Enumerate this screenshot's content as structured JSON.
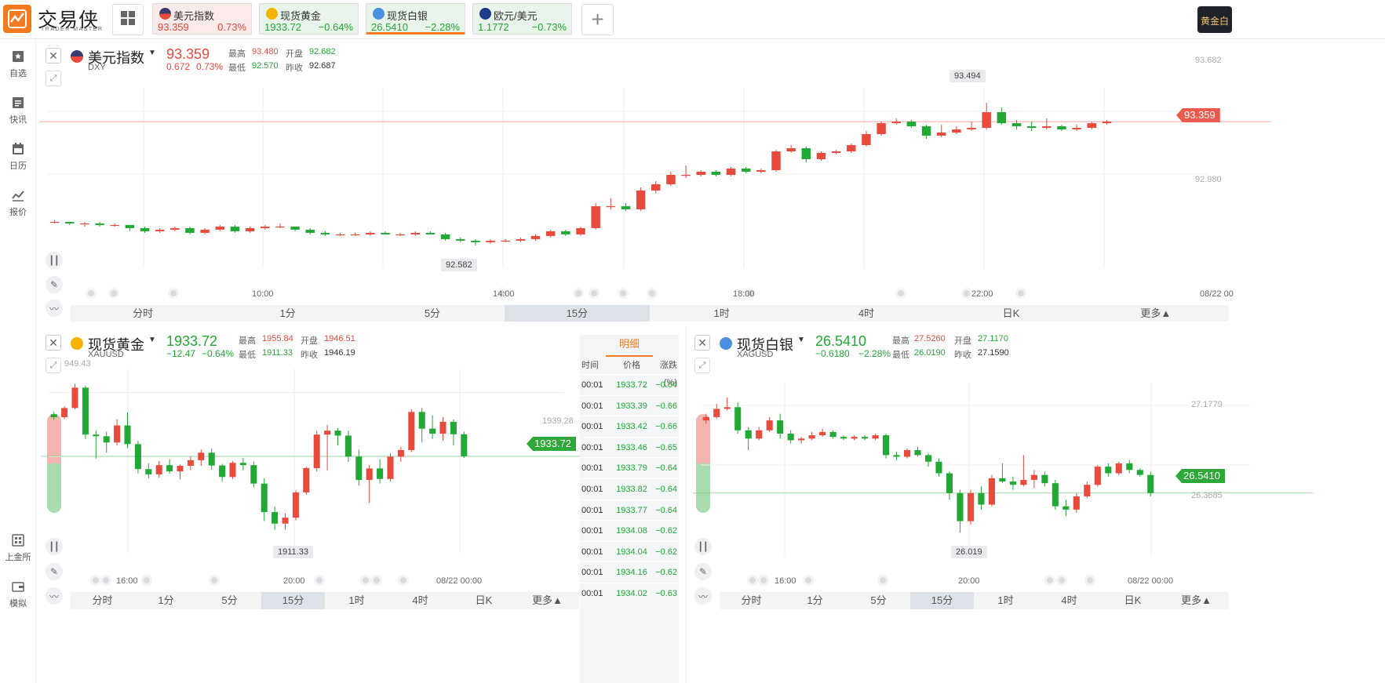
{
  "app": {
    "name": "交易侠",
    "sub": "TRADER MASTER",
    "right_badge": "黄金白"
  },
  "tickers": [
    {
      "name": "美元指数",
      "price": "93.359",
      "change": "0.73%",
      "dir": "up"
    },
    {
      "name": "现货黄金",
      "price": "1933.72",
      "change": "−0.64%",
      "dir": "down"
    },
    {
      "name": "现货白银",
      "price": "26.5410",
      "change": "−2.28%",
      "dir": "down"
    },
    {
      "name": "欧元/美元",
      "price": "1.1772",
      "change": "−0.73%",
      "dir": "down"
    }
  ],
  "sidebar": [
    {
      "label": "自选",
      "icon": "bookmark-icon"
    },
    {
      "label": "快讯",
      "icon": "news-icon"
    },
    {
      "label": "日历",
      "icon": "calendar-icon"
    },
    {
      "label": "报价",
      "icon": "chart-line-icon"
    },
    {
      "label": "上金所",
      "icon": "exchange-icon"
    },
    {
      "label": "模拟",
      "icon": "wallet-icon"
    }
  ],
  "timeframes": [
    "分时",
    "1分",
    "5分",
    "15分",
    "1时",
    "4时",
    "日K",
    "更多▲"
  ],
  "active_timeframe": "15分",
  "colors": {
    "up": "#e84a3c",
    "down": "#22a835",
    "accent": "#f47a1f"
  },
  "dxy": {
    "title": "美元指数",
    "code": "DXY",
    "price": "93.359",
    "chg": "0.672",
    "pct": "0.73%",
    "high_label": "最高",
    "high": "93.480",
    "open_label": "开盘",
    "open": "92.682",
    "low_label": "最低",
    "low": "92.570",
    "prev_label": "昨收",
    "prev": "92.687",
    "x_labels": [
      "10:00",
      "14:00",
      "18:00",
      "22:00",
      "08/22 00"
    ],
    "y_labels": [
      "93.682",
      "92.980"
    ],
    "hi_mark": "93.494",
    "lo_mark": "92.582",
    "last": "93.359"
  },
  "gold": {
    "title": "现货黄金",
    "code": "XAUUSD",
    "price": "1933.72",
    "chg": "−12.47",
    "pct": "−0.64%",
    "high_label": "最高",
    "high": "1955.84",
    "open_label": "开盘",
    "open": "1946.51",
    "low_label": "最低",
    "low": "1911.33",
    "prev_label": "昨收",
    "prev": "1946.19",
    "x_labels": [
      "16:00",
      "20:00",
      "08/22 00:00"
    ],
    "y_labels": [
      "1939.28"
    ],
    "top_partial": "949.43",
    "lo_mark": "1911.33",
    "last": "1933.72"
  },
  "silver": {
    "title": "现货白银",
    "code": "XAGUSD",
    "price": "26.5410",
    "chg": "−0.6180",
    "pct": "−2.28%",
    "high_label": "最高",
    "high": "27.5260",
    "open_label": "开盘",
    "open": "27.1170",
    "low_label": "最低",
    "low": "26.0190",
    "prev_label": "昨收",
    "prev": "27.1590",
    "x_labels": [
      "16:00",
      "20:00",
      "08/22 00:00"
    ],
    "y_labels": [
      "27.1779",
      "26.3685"
    ],
    "lo_mark": "26.019",
    "last": "26.5410"
  },
  "detail": {
    "tab": "明细",
    "headers": [
      "时间",
      "价格",
      "涨跌(%)"
    ],
    "rows": [
      [
        "00:01",
        "1933.72",
        "−0.64"
      ],
      [
        "00:01",
        "1933.39",
        "−0.66"
      ],
      [
        "00:01",
        "1933.42",
        "−0.66"
      ],
      [
        "00:01",
        "1933.46",
        "−0.65"
      ],
      [
        "00:01",
        "1933.79",
        "−0.64"
      ],
      [
        "00:01",
        "1933.82",
        "−0.64"
      ],
      [
        "00:01",
        "1933.77",
        "−0.64"
      ],
      [
        "00:01",
        "1934.08",
        "−0.62"
      ],
      [
        "00:01",
        "1934.04",
        "−0.62"
      ],
      [
        "00:01",
        "1934.16",
        "−0.62"
      ],
      [
        "00:01",
        "1934.02",
        "−0.63"
      ]
    ]
  },
  "chart_data": [
    {
      "type": "candlestick",
      "title": "美元指数",
      "candles": [
        [
          92.72,
          92.73,
          92.71,
          92.72
        ],
        [
          92.72,
          92.72,
          92.7,
          92.71
        ],
        [
          92.71,
          92.72,
          92.69,
          92.71
        ],
        [
          92.71,
          92.72,
          92.69,
          92.7
        ],
        [
          92.7,
          92.71,
          92.69,
          92.7
        ],
        [
          92.7,
          92.7,
          92.66,
          92.68
        ],
        [
          92.68,
          92.69,
          92.65,
          92.66
        ],
        [
          92.66,
          92.68,
          92.65,
          92.67
        ],
        [
          92.67,
          92.69,
          92.66,
          92.68
        ],
        [
          92.68,
          92.69,
          92.64,
          92.65
        ],
        [
          92.65,
          92.68,
          92.64,
          92.67
        ],
        [
          92.67,
          92.7,
          92.66,
          92.69
        ],
        [
          92.69,
          92.7,
          92.65,
          92.66
        ],
        [
          92.66,
          92.69,
          92.65,
          92.68
        ],
        [
          92.68,
          92.7,
          92.67,
          92.69
        ],
        [
          92.69,
          92.71,
          92.68,
          92.69
        ],
        [
          92.69,
          92.69,
          92.66,
          92.67
        ],
        [
          92.67,
          92.68,
          92.64,
          92.65
        ],
        [
          92.65,
          92.66,
          92.63,
          92.64
        ],
        [
          92.64,
          92.65,
          92.63,
          92.64
        ],
        [
          92.64,
          92.65,
          92.63,
          92.64
        ],
        [
          92.64,
          92.66,
          92.63,
          92.65
        ],
        [
          92.65,
          92.66,
          92.64,
          92.64
        ],
        [
          92.64,
          92.65,
          92.63,
          92.64
        ],
        [
          92.64,
          92.66,
          92.63,
          92.65
        ],
        [
          92.65,
          92.66,
          92.64,
          92.64
        ],
        [
          92.64,
          92.65,
          92.6,
          92.61
        ],
        [
          92.61,
          92.62,
          92.59,
          92.6
        ],
        [
          92.6,
          92.61,
          92.57,
          92.59
        ],
        [
          92.59,
          92.61,
          92.58,
          92.6
        ],
        [
          92.6,
          92.61,
          92.59,
          92.6
        ],
        [
          92.6,
          92.62,
          92.59,
          92.61
        ],
        [
          92.61,
          92.64,
          92.6,
          92.63
        ],
        [
          92.63,
          92.67,
          92.62,
          92.66
        ],
        [
          92.66,
          92.67,
          92.63,
          92.64
        ],
        [
          92.64,
          92.69,
          92.63,
          92.68
        ],
        [
          92.68,
          92.84,
          92.67,
          92.82
        ],
        [
          92.82,
          92.87,
          92.8,
          92.82
        ],
        [
          92.82,
          92.84,
          92.79,
          92.8
        ],
        [
          92.8,
          92.94,
          92.79,
          92.92
        ],
        [
          92.92,
          92.98,
          92.9,
          92.96
        ],
        [
          92.96,
          93.04,
          92.95,
          93.02
        ],
        [
          93.02,
          93.08,
          93.0,
          93.02
        ],
        [
          93.02,
          93.05,
          93.01,
          93.04
        ],
        [
          93.04,
          93.05,
          93.01,
          93.02
        ],
        [
          93.02,
          93.07,
          93.01,
          93.06
        ],
        [
          93.06,
          93.07,
          93.03,
          93.04
        ],
        [
          93.04,
          93.06,
          93.03,
          93.05
        ],
        [
          93.05,
          93.18,
          93.04,
          93.17
        ],
        [
          93.17,
          93.21,
          93.16,
          93.19
        ],
        [
          93.19,
          93.2,
          93.1,
          93.12
        ],
        [
          93.12,
          93.17,
          93.11,
          93.16
        ],
        [
          93.16,
          93.18,
          93.15,
          93.17
        ],
        [
          93.17,
          93.22,
          93.16,
          93.21
        ],
        [
          93.21,
          93.3,
          93.2,
          93.28
        ],
        [
          93.28,
          93.36,
          93.27,
          93.35
        ],
        [
          93.35,
          93.38,
          93.34,
          93.36
        ],
        [
          93.36,
          93.37,
          93.32,
          93.33
        ],
        [
          93.33,
          93.34,
          93.25,
          93.27
        ],
        [
          93.27,
          93.34,
          93.26,
          93.29
        ],
        [
          93.29,
          93.33,
          93.28,
          93.31
        ],
        [
          93.31,
          93.36,
          93.3,
          93.32
        ],
        [
          93.32,
          93.48,
          93.31,
          93.42
        ],
        [
          93.42,
          93.45,
          93.34,
          93.35
        ],
        [
          93.35,
          93.37,
          93.31,
          93.33
        ],
        [
          93.33,
          93.36,
          93.3,
          93.32
        ],
        [
          93.32,
          93.38,
          93.31,
          93.33
        ],
        [
          93.33,
          93.34,
          93.3,
          93.31
        ],
        [
          93.31,
          93.34,
          93.3,
          93.32
        ],
        [
          93.32,
          93.36,
          93.31,
          93.35
        ],
        [
          93.35,
          93.37,
          93.34,
          93.36
        ]
      ]
    },
    {
      "type": "candlestick",
      "title": "现货黄金",
      "candles": [
        [
          1946.5,
          1947.2,
          1944.8,
          1945.6
        ],
        [
          1945.6,
          1948.9,
          1945.0,
          1948.4
        ],
        [
          1948.4,
          1955.8,
          1948.0,
          1954.6
        ],
        [
          1954.6,
          1955.2,
          1939.0,
          1940.3
        ],
        [
          1940.3,
          1941.5,
          1933.0,
          1939.8
        ],
        [
          1939.8,
          1941.2,
          1934.8,
          1937.9
        ],
        [
          1937.9,
          1945.0,
          1937.0,
          1943.1
        ],
        [
          1943.1,
          1947.0,
          1936.2,
          1937.4
        ],
        [
          1937.4,
          1938.4,
          1928.5,
          1929.8
        ],
        [
          1929.8,
          1931.5,
          1927.0,
          1928.2
        ],
        [
          1928.2,
          1932.3,
          1927.2,
          1931.0
        ],
        [
          1931.0,
          1932.8,
          1928.4,
          1929.1
        ],
        [
          1929.1,
          1931.2,
          1926.7,
          1930.8
        ],
        [
          1930.8,
          1933.6,
          1929.5,
          1932.5
        ],
        [
          1932.5,
          1935.8,
          1930.8,
          1934.8
        ],
        [
          1934.8,
          1936.1,
          1929.6,
          1930.9
        ],
        [
          1930.9,
          1931.4,
          1926.0,
          1927.4
        ],
        [
          1927.4,
          1932.2,
          1926.8,
          1931.7
        ],
        [
          1931.7,
          1933.2,
          1929.4,
          1931.0
        ],
        [
          1931.0,
          1932.1,
          1924.2,
          1925.4
        ],
        [
          1925.4,
          1927.0,
          1914.0,
          1916.7
        ],
        [
          1916.7,
          1918.4,
          1911.3,
          1913.2
        ],
        [
          1913.2,
          1916.3,
          1911.3,
          1915.0
        ],
        [
          1915.0,
          1923.3,
          1914.2,
          1922.7
        ],
        [
          1922.7,
          1930.5,
          1922.0,
          1930.1
        ],
        [
          1930.1,
          1941.5,
          1929.0,
          1940.3
        ],
        [
          1940.3,
          1943.3,
          1929.4,
          1941.5
        ],
        [
          1941.5,
          1942.3,
          1937.0,
          1940.0
        ],
        [
          1940.0,
          1941.5,
          1932.0,
          1933.6
        ],
        [
          1933.6,
          1935.7,
          1924.8,
          1926.5
        ],
        [
          1926.5,
          1931.0,
          1919.5,
          1930.0
        ],
        [
          1930.0,
          1932.8,
          1925.4,
          1926.8
        ],
        [
          1926.8,
          1934.6,
          1926.0,
          1933.6
        ],
        [
          1933.6,
          1936.6,
          1932.0,
          1935.6
        ],
        [
          1935.6,
          1948.0,
          1935.0,
          1947.2
        ],
        [
          1947.2,
          1948.4,
          1938.0,
          1942.1
        ],
        [
          1942.1,
          1946.2,
          1939.0,
          1940.6
        ],
        [
          1940.6,
          1945.6,
          1938.5,
          1944.2
        ],
        [
          1944.2,
          1944.9,
          1937.0,
          1940.4
        ],
        [
          1940.4,
          1941.2,
          1933.2,
          1933.7
        ]
      ]
    },
    {
      "type": "candlestick",
      "title": "现货白银",
      "candles": [
        [
          27.16,
          27.2,
          27.14,
          27.18
        ],
        [
          27.18,
          27.26,
          27.17,
          27.23
        ],
        [
          27.23,
          27.3,
          27.22,
          27.24
        ],
        [
          27.24,
          27.27,
          27.08,
          27.1
        ],
        [
          27.1,
          27.12,
          26.98,
          27.05
        ],
        [
          27.05,
          27.12,
          27.04,
          27.1
        ],
        [
          27.1,
          27.18,
          27.09,
          27.16
        ],
        [
          27.16,
          27.2,
          27.05,
          27.08
        ],
        [
          27.08,
          27.1,
          27.02,
          27.04
        ],
        [
          27.04,
          27.06,
          27.02,
          27.05
        ],
        [
          27.05,
          27.09,
          27.04,
          27.07
        ],
        [
          27.07,
          27.11,
          27.06,
          27.09
        ],
        [
          27.09,
          27.1,
          27.05,
          27.06
        ],
        [
          27.06,
          27.07,
          27.04,
          27.05
        ],
        [
          27.05,
          27.07,
          27.04,
          27.06
        ],
        [
          27.06,
          27.07,
          27.04,
          27.05
        ],
        [
          27.05,
          27.08,
          27.04,
          27.07
        ],
        [
          27.07,
          27.08,
          26.93,
          26.95
        ],
        [
          26.95,
          26.97,
          26.92,
          26.94
        ],
        [
          26.94,
          26.99,
          26.93,
          26.98
        ],
        [
          26.98,
          27.0,
          26.94,
          26.95
        ],
        [
          26.95,
          26.96,
          26.88,
          26.91
        ],
        [
          26.91,
          26.93,
          26.82,
          26.84
        ],
        [
          26.84,
          26.85,
          26.68,
          26.72
        ],
        [
          26.72,
          26.74,
          26.48,
          26.55
        ],
        [
          26.55,
          26.74,
          26.53,
          26.72
        ],
        [
          26.72,
          26.76,
          26.62,
          26.65
        ],
        [
          26.65,
          26.83,
          26.64,
          26.81
        ],
        [
          26.81,
          26.9,
          26.78,
          26.79
        ],
        [
          26.79,
          26.82,
          26.74,
          26.77
        ],
        [
          26.77,
          26.95,
          26.76,
          26.8
        ],
        [
          26.8,
          26.86,
          26.75,
          26.83
        ],
        [
          26.83,
          26.85,
          26.76,
          26.78
        ],
        [
          26.78,
          26.8,
          26.62,
          26.64
        ],
        [
          26.64,
          26.68,
          26.58,
          26.62
        ],
        [
          26.62,
          26.72,
          26.6,
          26.7
        ],
        [
          26.7,
          26.79,
          26.69,
          26.77
        ],
        [
          26.77,
          26.89,
          26.76,
          26.88
        ],
        [
          26.88,
          26.9,
          26.82,
          26.84
        ],
        [
          26.84,
          26.91,
          26.83,
          26.9
        ],
        [
          26.9,
          26.92,
          26.84,
          26.86
        ],
        [
          26.86,
          26.87,
          26.82,
          26.83
        ],
        [
          26.83,
          26.85,
          26.7,
          26.72
        ]
      ]
    }
  ]
}
